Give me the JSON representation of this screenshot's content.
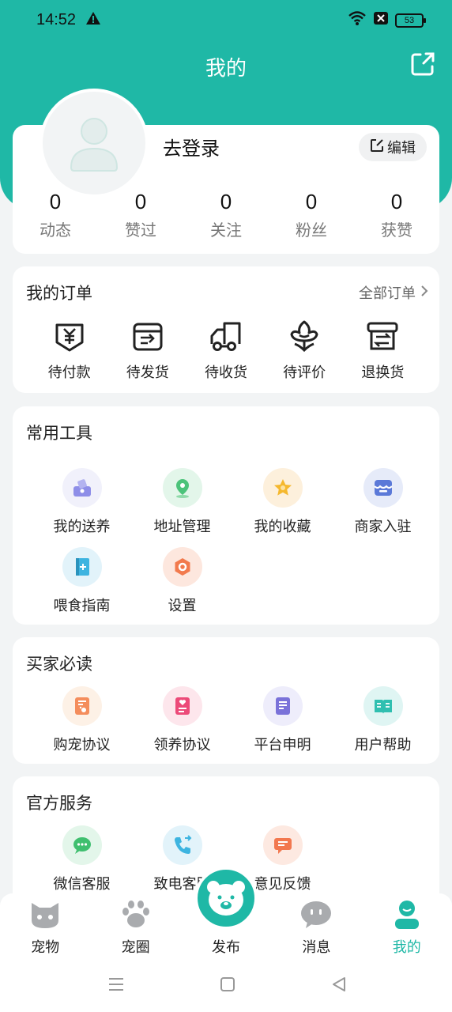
{
  "status": {
    "time": "14:52",
    "battery": "53"
  },
  "header": {
    "title": "我的"
  },
  "profile": {
    "login_text": "去登录",
    "edit_label": "编辑",
    "stats": [
      {
        "value": "0",
        "label": "动态"
      },
      {
        "value": "0",
        "label": "赞过"
      },
      {
        "value": "0",
        "label": "关注"
      },
      {
        "value": "0",
        "label": "粉丝"
      },
      {
        "value": "0",
        "label": "获赞"
      }
    ]
  },
  "orders": {
    "title": "我的订单",
    "all_label": "全部订单",
    "items": [
      {
        "label": "待付款",
        "icon": "payment-icon"
      },
      {
        "label": "待发货",
        "icon": "shipping-box-icon"
      },
      {
        "label": "待收货",
        "icon": "truck-icon"
      },
      {
        "label": "待评价",
        "icon": "flower-review-icon"
      },
      {
        "label": "退换货",
        "icon": "return-box-icon"
      }
    ]
  },
  "tools": {
    "title": "常用工具",
    "items": [
      {
        "label": "我的送养",
        "icon": "pet-adopt-icon"
      },
      {
        "label": "地址管理",
        "icon": "location-icon"
      },
      {
        "label": "我的收藏",
        "icon": "star-icon"
      },
      {
        "label": "商家入驻",
        "icon": "store-icon"
      },
      {
        "label": "喂食指南",
        "icon": "guide-book-icon"
      },
      {
        "label": "设置",
        "icon": "settings-icon"
      }
    ]
  },
  "reads": {
    "title": "买家必读",
    "items": [
      {
        "label": "购宠协议",
        "icon": "paw-document-icon"
      },
      {
        "label": "领养协议",
        "icon": "heart-document-icon"
      },
      {
        "label": "平台申明",
        "icon": "document-icon"
      },
      {
        "label": "用户帮助",
        "icon": "help-book-icon"
      }
    ]
  },
  "service": {
    "title": "官方服务",
    "items": [
      {
        "label": "微信客服",
        "icon": "wechat-service-icon"
      },
      {
        "label": "致电客服",
        "icon": "phone-icon"
      },
      {
        "label": "意见反馈",
        "icon": "feedback-icon"
      }
    ]
  },
  "tabbar": {
    "items": [
      {
        "label": "宠物",
        "icon": "cat-icon"
      },
      {
        "label": "宠圈",
        "icon": "paw-icon"
      },
      {
        "label": "发布",
        "icon": "bear-publish-icon"
      },
      {
        "label": "消息",
        "icon": "message-icon"
      },
      {
        "label": "我的",
        "icon": "user-icon"
      }
    ]
  },
  "colors": {
    "accent": "#1fb8a6",
    "background": "#f2f4f5"
  }
}
